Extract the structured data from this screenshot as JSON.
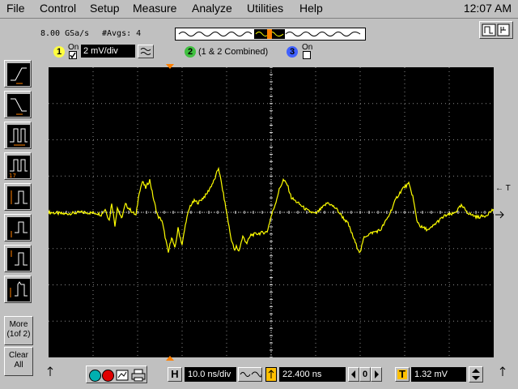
{
  "menu": {
    "file": "File",
    "control": "Control",
    "setup": "Setup",
    "measure": "Measure",
    "analyze": "Analyze",
    "utilities": "Utilities",
    "help": "Help"
  },
  "clock": "12:07 AM",
  "status": {
    "sample_rate": "8.00 GSa/s",
    "averages": "#Avgs: 4"
  },
  "channels": [
    {
      "number": "1",
      "on_label": "On",
      "checked": true,
      "scale": "2 mV/div",
      "color": "#ffff40"
    },
    {
      "number": "2",
      "label": "(1 & 2 Combined)",
      "color": "#40c040"
    },
    {
      "number": "3",
      "on_label": "On",
      "checked": false,
      "color": "#4060ff"
    }
  ],
  "sidebar": {
    "more_label_1": "More",
    "more_label_2": "(1of 2)",
    "clear_label_1": "Clear",
    "clear_label_2": "All",
    "tool_extra": "17"
  },
  "right_marker": "← T",
  "bottom": {
    "h_label": "H",
    "timebase": "10.0 ns/div",
    "delay": "22.400 ns",
    "ref_value": "0",
    "trigger_label": "T",
    "trigger_level": "1.32 mV"
  },
  "colors": {
    "trace": "#ffff00",
    "grid": "#8c8c8c",
    "marker": "#ff8000"
  }
}
